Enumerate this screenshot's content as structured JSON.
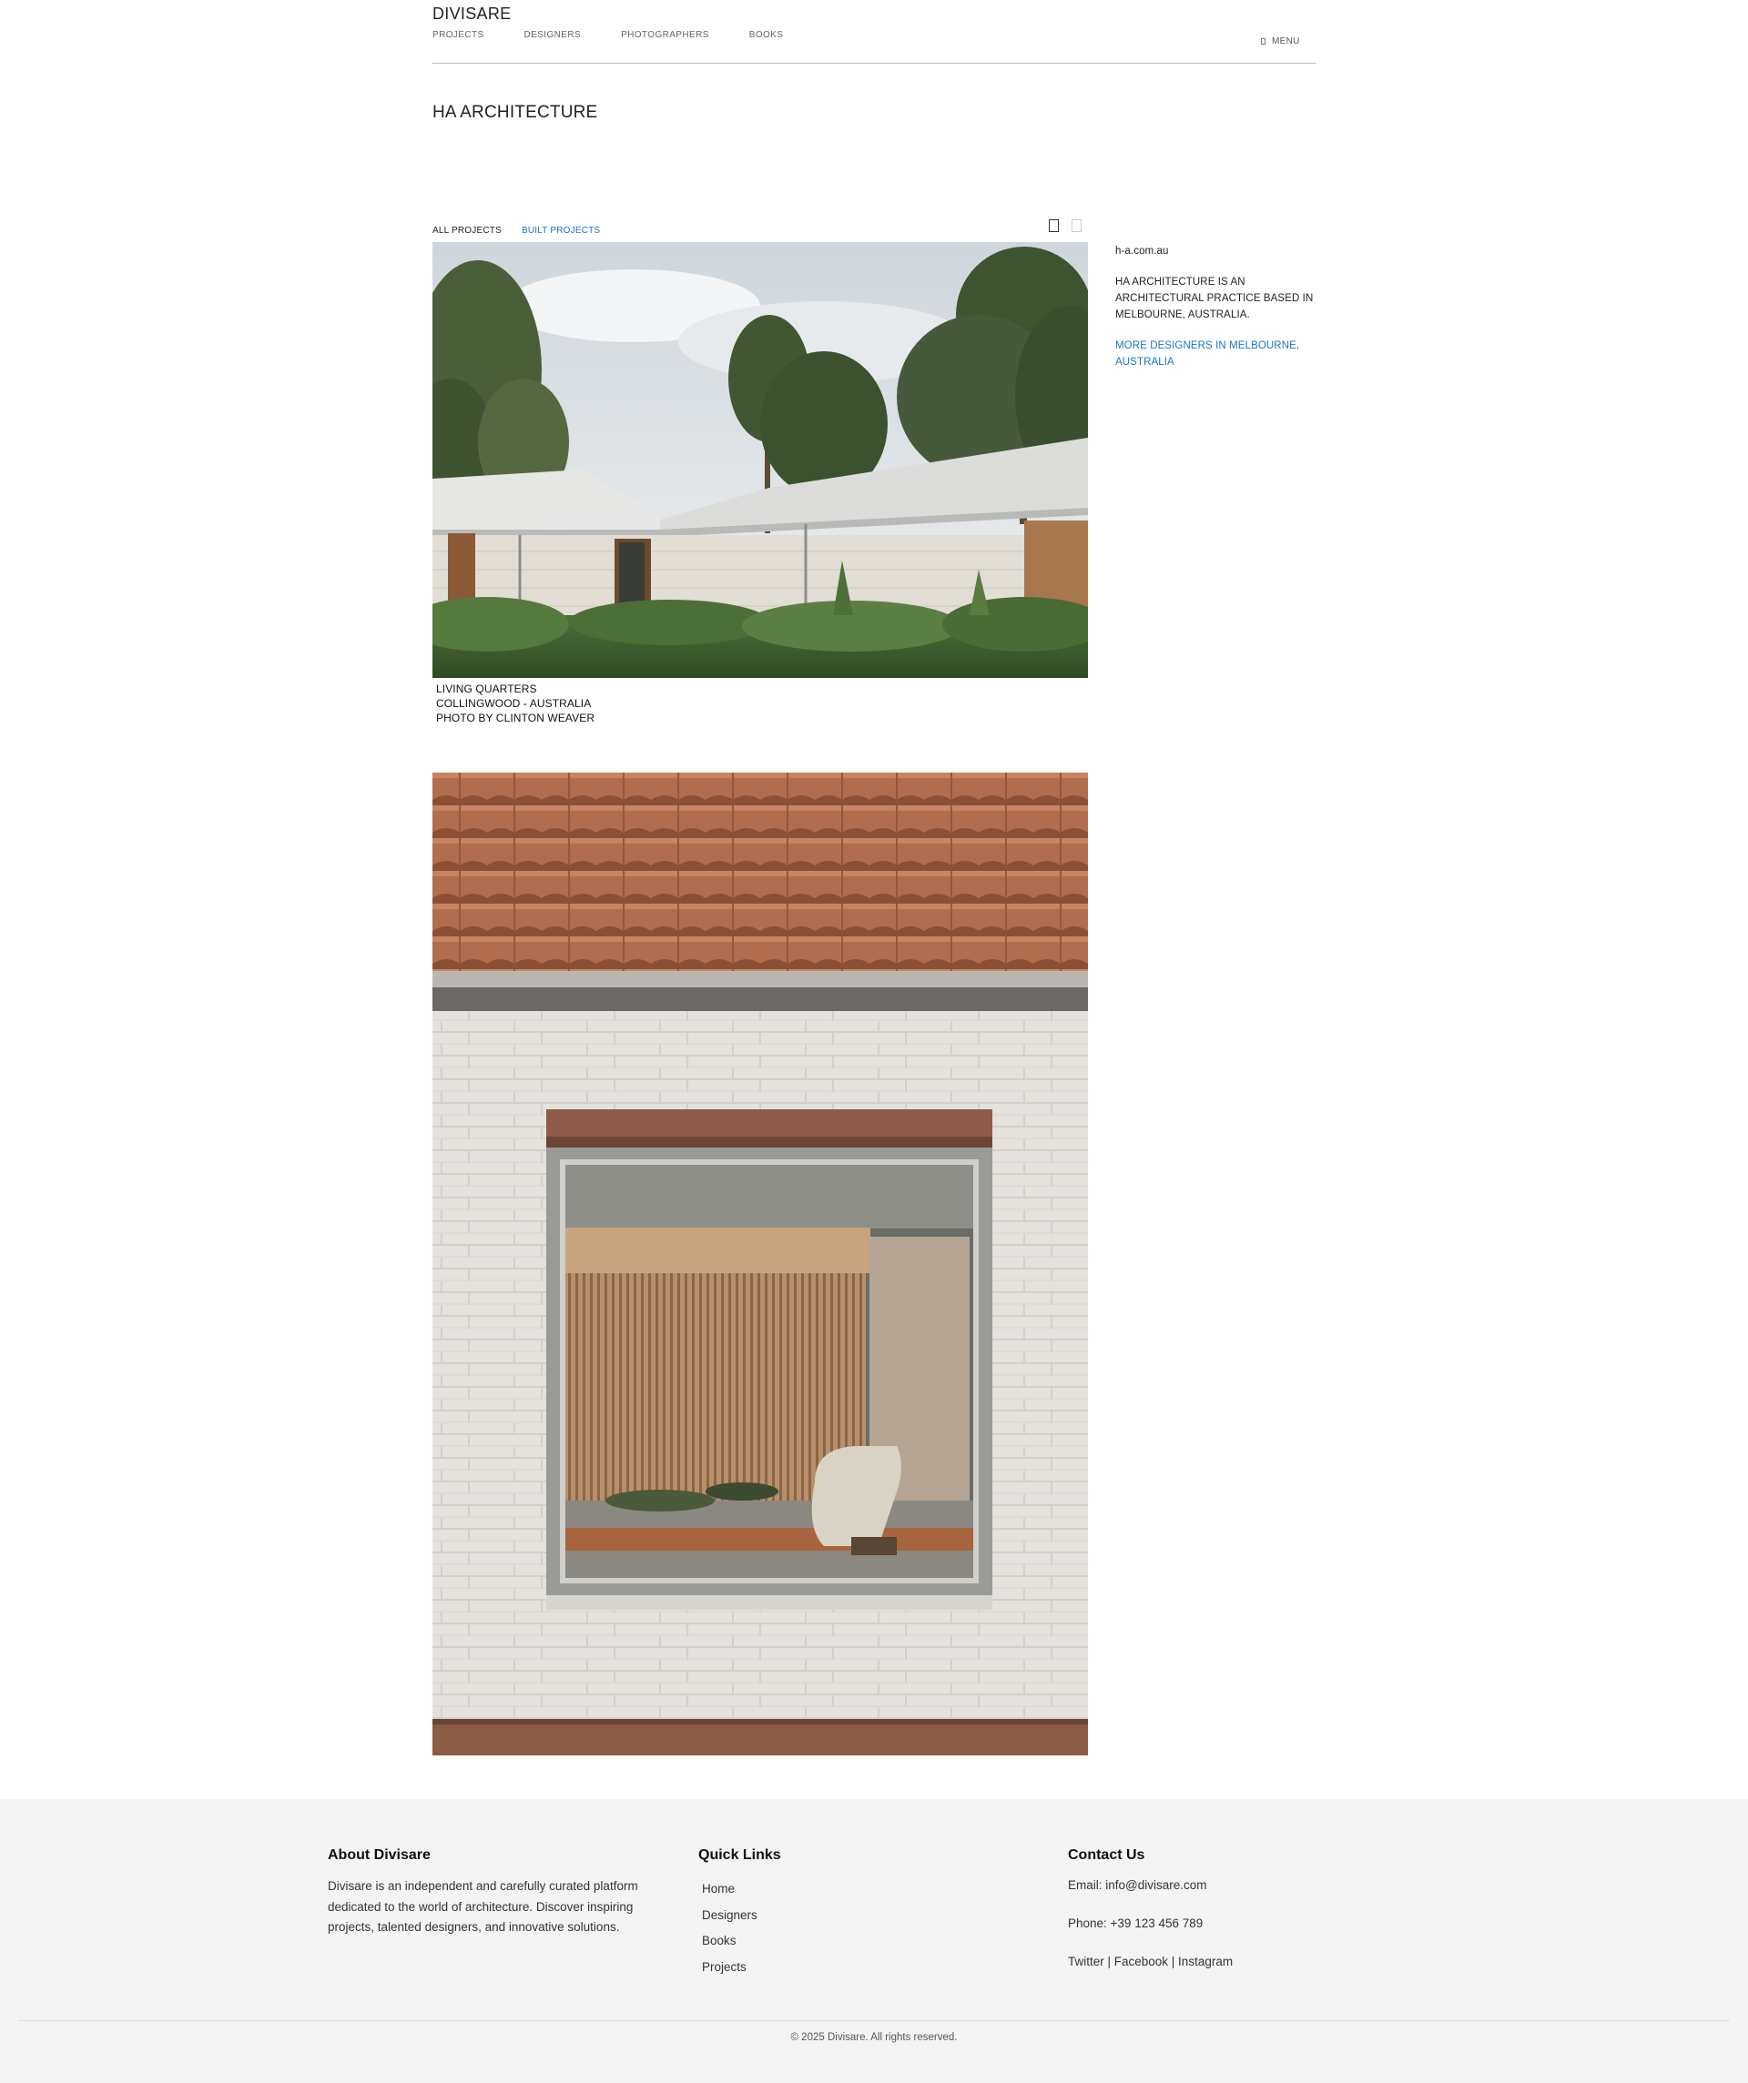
{
  "header": {
    "brand": "DIVISARE",
    "nav": [
      "PROJECTS",
      "DESIGNERS",
      "PHOTOGRAPHERS",
      "BOOKS"
    ],
    "menu_label": "MENU"
  },
  "page": {
    "title": "HA ARCHITECTURE",
    "tabs": {
      "all": "ALL PROJECTS",
      "built": "BUILT PROJECTS"
    },
    "accent_color": "#1a73c8"
  },
  "projects": [
    {
      "name": "LIVING QUARTERS",
      "location": "COLLINGWOOD - AUSTRALIA",
      "credit": "PHOTO BY CLINTON WEAVER",
      "image": "house-with-white-roof-photo"
    },
    {
      "image": "brick-wall-window-photo"
    }
  ],
  "sidebar": {
    "url": "h-a.com.au",
    "description": "HA ARCHITECTURE IS AN ARCHITECTURAL PRACTICE BASED IN MELBOURNE, AUSTRALIA.",
    "more_link": "MORE DESIGNERS IN MELBOURNE, AUSTRALIA"
  },
  "footer": {
    "about": {
      "heading": "About Divisare",
      "text": "Divisare is an independent and carefully curated platform dedicated to the world of architecture. Discover inspiring projects, talented designers, and innovative solutions."
    },
    "links": {
      "heading": "Quick Links",
      "items": [
        "Home",
        "Designers",
        "Books",
        "Projects"
      ]
    },
    "contact": {
      "heading": "Contact Us",
      "email": "Email: info@divisare.com",
      "phone": "Phone: +39 123 456 789",
      "social": "Twitter | Facebook | Instagram"
    },
    "copyright": "© 2025 Divisare. All rights reserved."
  }
}
